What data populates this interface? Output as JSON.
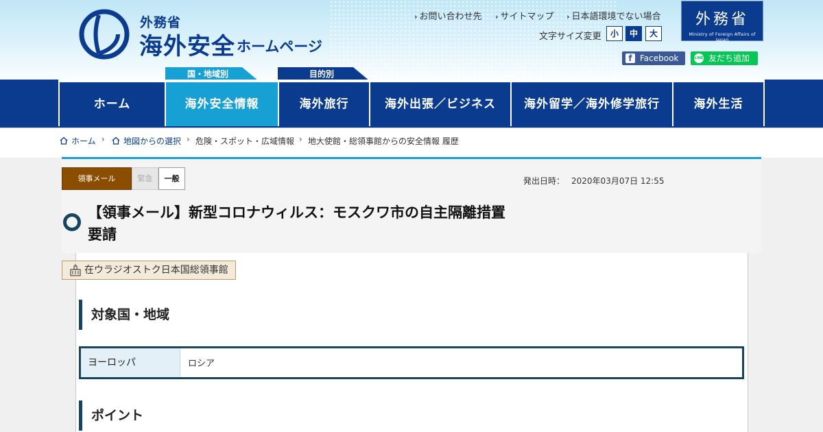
{
  "header": {
    "logo_small": "外務省",
    "logo_big": "海外安全",
    "logo_sub": "ホームページ",
    "util_links": [
      "お問い合わせ先",
      "サイトマップ",
      "日本語環境でない場合"
    ],
    "font_size_label": "文字サイズ変更",
    "font_sizes": [
      "小",
      "中",
      "大"
    ],
    "font_size_selected": "中",
    "mofa_kanji": "外務省",
    "mofa_english": "Ministry of Foreign Affairs of Japan",
    "facebook_label": "Facebook",
    "line_icon": "LINE",
    "line_label": "友だち追加",
    "tab_tags": [
      "国・地域別",
      "目的別"
    ]
  },
  "nav": {
    "items": [
      "ホーム",
      "海外安全情報",
      "海外旅行",
      "海外出張／ビジネス",
      "海外留学／海外修学旅行",
      "海外生活"
    ],
    "active": "海外安全情報"
  },
  "breadcrumb": [
    "ホーム",
    "地図からの選択",
    "危険・スポット・広域情報",
    "地大使館・総領事館からの安全情報 履歴"
  ],
  "article": {
    "tags": [
      "領事メール",
      "緊急",
      "一般"
    ],
    "issued_label": "発出日時：",
    "issued_value": "2020年03月07日 12:55",
    "title_line1": "【領事メール】新型コロナウィルス：モスクワ市の自主隔離措置",
    "title_line2": "要請",
    "office": "在ウラジオストク日本国総領事館",
    "section_target": "対象国・地域",
    "region_label": "ヨーロッパ",
    "region_value": "ロシア",
    "section_point": "ポイント"
  },
  "colors": {
    "navy": "#0a3b8f",
    "cyan": "#17a0d4",
    "brown": "#8b4d00",
    "dark_teal": "#17445f"
  }
}
